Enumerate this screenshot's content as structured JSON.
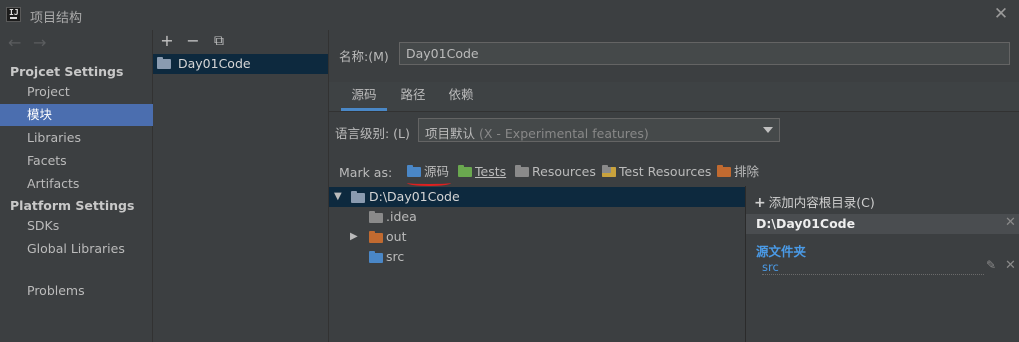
{
  "window": {
    "title": "项目结构",
    "close_icon": "close-icon"
  },
  "colors": {
    "selection": "#4b6eaf",
    "tree_selection": "#0d293e",
    "folder_blue": "#4a87c7",
    "folder_green": "#6aa84f",
    "folder_gray": "#8a8a8a",
    "folder_orange": "#c16a30",
    "underline_red": "#e02020",
    "link_blue": "#4a9ae6"
  },
  "left_nav": {
    "back_icon": "arrow-left-icon",
    "forward_icon": "arrow-right-icon",
    "project_settings_title": "Projcet Settings",
    "project_items": [
      "Project",
      "模块",
      "Libraries",
      "Facets",
      "Artifacts"
    ],
    "platform_settings_title": "Platform Settings",
    "platform_items": [
      "SDKs",
      "Global Libraries"
    ],
    "other_items": [
      "Problems"
    ],
    "selected": "模块"
  },
  "module_panel": {
    "toolbar": [
      "+",
      "−",
      "⧉"
    ],
    "modules": [
      "Day01Code"
    ]
  },
  "module_detail": {
    "name_label": "名称:(M)",
    "name_value": "Day01Code",
    "tabs": [
      "源码",
      "路径",
      "依赖"
    ],
    "active_tab": "源码",
    "language_level_label": "语言级别: (L)",
    "language_level_value": "项目默认",
    "language_level_hint": "(X - Experimental features)",
    "mark_as_label": "Mark as:",
    "mark_as": [
      "源码",
      "Tests",
      "Resources",
      "Test Resources",
      "排除"
    ]
  },
  "tree": {
    "root": "D:\\Day01Code",
    "children": [
      ".idea",
      "out",
      "src"
    ]
  },
  "content_roots": {
    "add_label": "添加内容根目录(C)",
    "root_path": "D:\\Day01Code",
    "source_folders_title": "源文件夹",
    "source_folders": [
      "src"
    ]
  }
}
